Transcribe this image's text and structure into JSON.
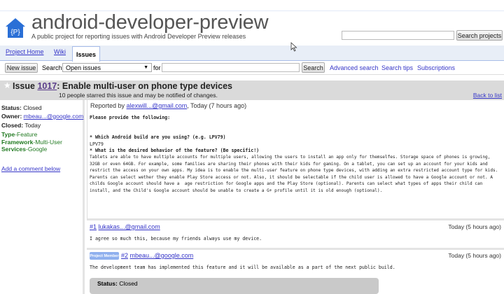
{
  "header": {
    "title": "android-developer-preview",
    "subtitle": "A public project for reporting issues with Android Developer Preview releases",
    "logo_text": "{P}",
    "search_projects_button": "Search projects",
    "search_projects_value": ""
  },
  "tabs": [
    {
      "label": "Project Home"
    },
    {
      "label": "Wiki"
    },
    {
      "label": "Issues",
      "active": true
    }
  ],
  "toolbar": {
    "new_issue": "New issue",
    "search_label": "Search",
    "select_value": "Open issues",
    "for_label": "for",
    "query_value": "",
    "search_button": "Search",
    "links": [
      "Advanced search",
      "Search tips",
      "Subscriptions"
    ]
  },
  "issue": {
    "prefix": "Issue",
    "number": "1017",
    "title": ": Enable multi-user on phone type devices",
    "starred": "10 people starred this issue and may be notified of changes.",
    "back_to_list": "Back to list"
  },
  "meta": {
    "status_label": "Status:",
    "status": "Closed",
    "owner_label": "Owner:",
    "owner": "mbeau...@google.com",
    "closed_label": "Closed:",
    "closed": "Today",
    "labels": [
      {
        "key": "Type",
        "value": "-Feature"
      },
      {
        "key": "Framework",
        "value": "-Multi-User"
      },
      {
        "key": "Services",
        "value": "-Google"
      }
    ],
    "add_comment": "Add a comment below"
  },
  "description": {
    "reported_prefix": "Reported by",
    "reporter": "alexwill...@gmail.com",
    "reported_when": ", Today (7 hours ago)",
    "heading": "Please provide the following:",
    "q1": "* Which Android build are you using? (e.g. LPV79)",
    "a1": "LPV79",
    "q2": "* What is the desired behavior of the feature? (Be specific!)",
    "a2": "Tablets are able to have multiple accounts for multiple users, allowing the users to install an app only for themselfes. Storage space of phones is growing, 32GB or even 64GB. For example, some families are sharing their phones with their kids for gaming. On a tablet, you can set up an account for your kids and restrict the access on your own apps. My idea is to enable the multi-user feature on phone type devices, with adding an extra restricted account type for kids.\nParents can select wether they enable Play Store access or not. Also, it should be selectable if the child user is allowed to have a Google account or not. A childs Google account should have a  age restriction for Google apps and the Play Store (optional). Parents can select what types of apps their child can install, and the Child's Google account should be unable to create a G+ profile until it is old enough (optional)."
  },
  "comments": [
    {
      "num": "#1",
      "author": "lukakas...@gmail.com",
      "when": "Today (5 hours ago)",
      "text": "I agree so much this, because my friends always use my device."
    },
    {
      "badge": "Project Member",
      "num": "#2",
      "author": "mbeau...@google.com",
      "when": "Today (5 hours ago)",
      "text": "The development team has implemented this feature and it will be available as a part of the next public build.",
      "status_label": "Status:",
      "status": "Closed"
    }
  ],
  "colors": {
    "tabbar": "#e8eef7",
    "link": "#3636c8",
    "label_green": "#217a21",
    "issue_header": "#dadada"
  }
}
